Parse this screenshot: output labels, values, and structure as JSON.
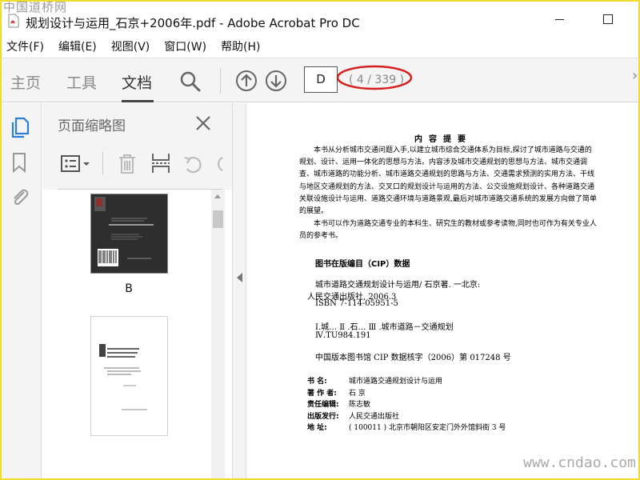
{
  "watermark_top": "中国道桥网",
  "watermark_bottom": "www.cndao.com",
  "window": {
    "title": "规划设计与运用_石京+2006年.pdf - Adobe Acrobat Pro DC"
  },
  "menu": {
    "items": [
      "文件(F)",
      "编辑(E)",
      "视图(V)",
      "窗口(W)",
      "帮助(H)"
    ]
  },
  "toolbar": {
    "tabs": {
      "home": "主页",
      "tools": "工具",
      "document": "文档"
    },
    "page_input": "D",
    "page_count": "( 4 / 339 )"
  },
  "thumbnails": {
    "title": "页面缩略图",
    "pages": [
      {
        "label": "B"
      }
    ]
  },
  "document": {
    "heading": "内容提要",
    "para1": "本书从分析城市交通问题入手,以建立城市综合交通体系为目标,探讨了城市道路与交通的规划、设计、运用一体化的思想与方法。内容涉及城市交通规划的思想与方法、城市交通调查、城市道路的功能分析、城市道路交通规划的思路与方法、交通需求预测的实用方法、干线与地区交通规划的方法、交叉口的规划设计与运用的方法、公交设施规划设计、各种道路交通关联设施设计与运用、道路交通环境与道路景观,最后对城市道路交通系统的发展方向做了简单的展望。",
    "para2": "本书可以作为道路交通专业的本科生、研究生的教材或参考读物,同时也可作为有关专业人员的参考书。",
    "cip_heading": "图书在版编目（CIP）数据",
    "cip_lines": [
      "城市道路交通规划设计与运用/ 石京著. 一北京:",
      "人民交通出版社, 2006.3",
      "ISBN 7-114-05951-5",
      "Ⅰ.城…  Ⅱ .石…  Ⅲ .城市道路－交通规划",
      "Ⅳ.TU984.191",
      "中国版本图书馆 CIP 数据核字（2006）第 017248 号"
    ],
    "colophon": [
      {
        "key": "书      名:",
        "value": "城市道路交通规划设计与运用"
      },
      {
        "key": "著  作  者:",
        "value": "石   京"
      },
      {
        "key": "责任编辑:",
        "value": "陈志敏"
      },
      {
        "key": "出版发行:",
        "value": "人民交通出版社"
      },
      {
        "key": "地      址:",
        "value": "( 100011 ) 北京市朝阳区安定门外外馆斜街 3 号"
      }
    ]
  },
  "colors": {
    "accent_red": "#d42020",
    "toolbar_bg": "#f4f4f4",
    "frame_yellow": "#f0dc2a",
    "icon_blue": "#2d7fd6"
  }
}
